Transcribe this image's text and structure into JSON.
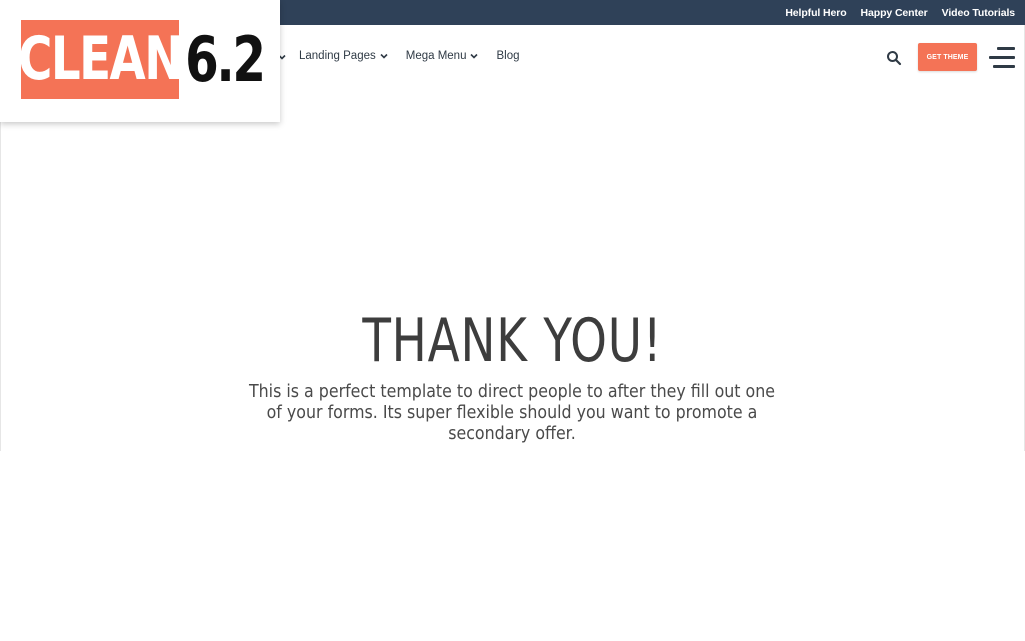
{
  "topbar": {
    "links": [
      "Helpful Hero",
      "Happy Center",
      "Video Tutorials"
    ]
  },
  "logo": {
    "word": "CLEAN",
    "version": "6.2"
  },
  "nav": {
    "items": [
      {
        "label": "Landing Pages",
        "has_dropdown": true
      },
      {
        "label": "Mega Menu",
        "has_dropdown": true
      },
      {
        "label": "Blog",
        "has_dropdown": false
      }
    ]
  },
  "header": {
    "cta_label": "GET THEME"
  },
  "hero": {
    "title": "THANK YOU!",
    "text": "This is a perfect template to direct people to after they fill out one of your forms. Its super flexible should you want to promote a secondary offer."
  },
  "colors": {
    "topbar": "#2f4158",
    "accent": "#f47356",
    "text_dark": "#3d3d3d"
  }
}
